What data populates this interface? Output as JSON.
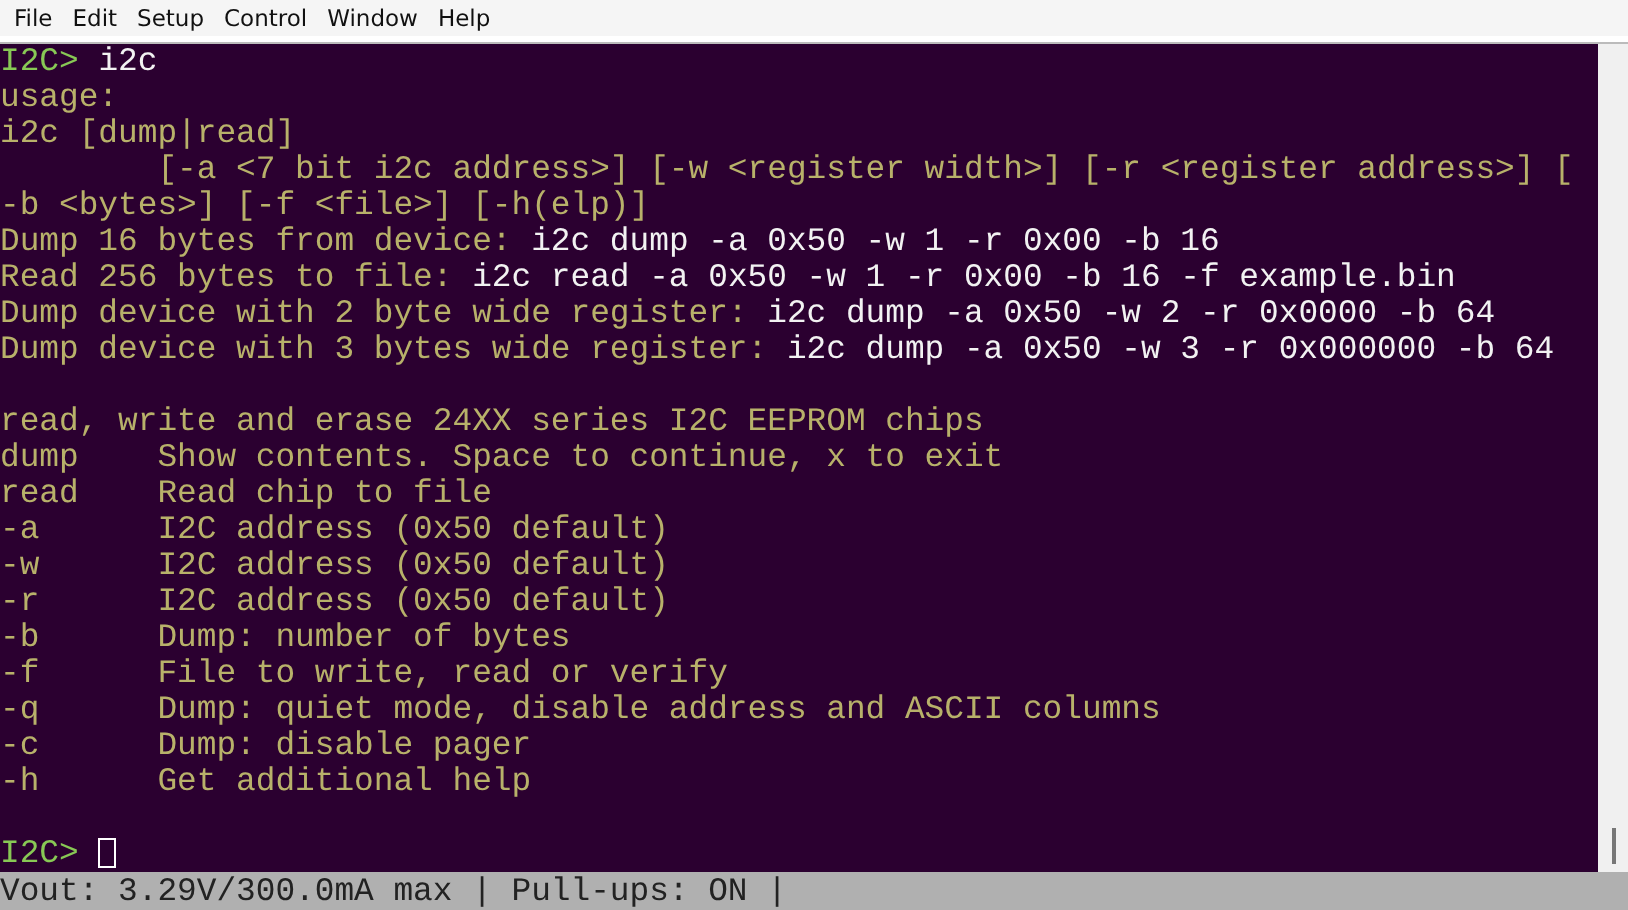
{
  "menu": [
    "File",
    "Edit",
    "Setup",
    "Control",
    "Window",
    "Help"
  ],
  "terminal": {
    "lines": [
      {
        "kind": "text",
        "segments": [
          {
            "kind": "prompt",
            "text": "I2C>"
          },
          {
            "kind": "input",
            "text": " i2c"
          }
        ]
      },
      {
        "kind": "text",
        "segments": [
          {
            "kind": "help",
            "text": "usage:"
          }
        ]
      },
      {
        "kind": "text",
        "segments": [
          {
            "kind": "help",
            "text": "i2c [dump|read]"
          }
        ]
      },
      {
        "kind": "text",
        "segments": [
          {
            "kind": "help",
            "text": "        [-a <7 bit i2c address>] [-w <register width>] [-r <register address>] ["
          }
        ]
      },
      {
        "kind": "text",
        "segments": [
          {
            "kind": "help",
            "text": "-b <bytes>] [-f <file>] [-h(elp)]"
          }
        ]
      },
      {
        "kind": "text",
        "segments": [
          {
            "kind": "help",
            "text": "Dump 16 bytes from device:"
          },
          {
            "kind": "input",
            "text": " i2c dump -a 0x50 -w 1 -r 0x00 -b 16"
          }
        ]
      },
      {
        "kind": "text",
        "segments": [
          {
            "kind": "help",
            "text": "Read 256 bytes to file:"
          },
          {
            "kind": "input",
            "text": " i2c read -a 0x50 -w 1 -r 0x00 -b 16 -f example.bin"
          }
        ]
      },
      {
        "kind": "text",
        "segments": [
          {
            "kind": "help",
            "text": "Dump device with 2 byte wide register:"
          },
          {
            "kind": "input",
            "text": " i2c dump -a 0x50 -w 2 -r 0x0000 -b 64"
          }
        ]
      },
      {
        "kind": "text",
        "segments": [
          {
            "kind": "help",
            "text": "Dump device with 3 bytes wide register:"
          },
          {
            "kind": "input",
            "text": " i2c dump -a 0x50 -w 3 -r 0x000000 -b 64"
          }
        ]
      },
      {
        "kind": "blank"
      },
      {
        "kind": "text",
        "segments": [
          {
            "kind": "help",
            "text": "read, write and erase 24XX series I2C EEPROM chips"
          }
        ]
      },
      {
        "kind": "text",
        "segments": [
          {
            "kind": "help",
            "text": "dump    Show contents. Space to continue, x to exit"
          }
        ]
      },
      {
        "kind": "text",
        "segments": [
          {
            "kind": "help",
            "text": "read    Read chip to file"
          }
        ]
      },
      {
        "kind": "text",
        "segments": [
          {
            "kind": "help",
            "text": "-a      I2C address (0x50 default)"
          }
        ]
      },
      {
        "kind": "text",
        "segments": [
          {
            "kind": "help",
            "text": "-w      I2C address (0x50 default)"
          }
        ]
      },
      {
        "kind": "text",
        "segments": [
          {
            "kind": "help",
            "text": "-r      I2C address (0x50 default)"
          }
        ]
      },
      {
        "kind": "text",
        "segments": [
          {
            "kind": "help",
            "text": "-b      Dump: number of bytes"
          }
        ]
      },
      {
        "kind": "text",
        "segments": [
          {
            "kind": "help",
            "text": "-f      File to write, read or verify"
          }
        ]
      },
      {
        "kind": "text",
        "segments": [
          {
            "kind": "help",
            "text": "-q      Dump: quiet mode, disable address and ASCII columns"
          }
        ]
      },
      {
        "kind": "text",
        "segments": [
          {
            "kind": "help",
            "text": "-c      Dump: disable pager"
          }
        ]
      },
      {
        "kind": "text",
        "segments": [
          {
            "kind": "help",
            "text": "-h      Get additional help"
          }
        ]
      },
      {
        "kind": "blank"
      },
      {
        "kind": "text",
        "segments": [
          {
            "kind": "prompt",
            "text": "I2C>"
          },
          {
            "kind": "cursor"
          }
        ]
      }
    ]
  },
  "status_bar": "Vout: 3.29V/300.0mA max | Pull-ups: ON |"
}
